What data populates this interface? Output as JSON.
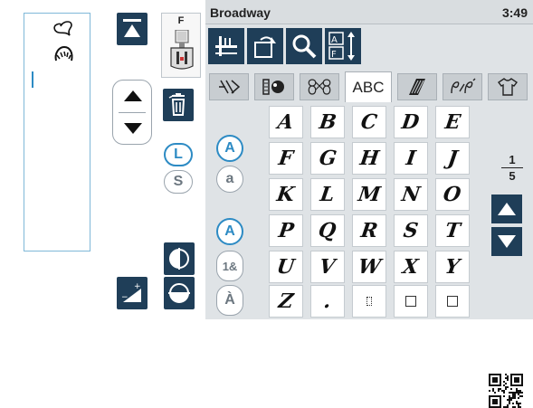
{
  "header": {
    "pattern_name": "Broadway",
    "clock": "3:49"
  },
  "left": {
    "presser_foot": "F",
    "case_upper": "L",
    "case_lower": "S"
  },
  "tabs": [
    {
      "label": "",
      "icon": "utility-stitch-icon"
    },
    {
      "label": "",
      "icon": "quilt-stitch-icon"
    },
    {
      "label": "",
      "icon": "decorative-stitch-icon"
    },
    {
      "label": "ABC",
      "icon": ""
    },
    {
      "label": "",
      "icon": "tapering-icon"
    },
    {
      "label": "",
      "icon": "motif-icon"
    },
    {
      "label": "",
      "icon": "garment-icon"
    }
  ],
  "active_tab": 3,
  "char_modes": {
    "uppercase": "A",
    "lowercase": "a",
    "numbers": "1&",
    "accented": "À"
  },
  "characters": [
    "A",
    "B",
    "C",
    "D",
    "E",
    "F",
    "G",
    "H",
    "I",
    "J",
    "K",
    "L",
    "M",
    "N",
    "O",
    "P",
    "Q",
    "R",
    "S",
    "T",
    "U",
    "V",
    "W",
    "X",
    "Y",
    "Z",
    "."
  ],
  "page": {
    "current": "1",
    "total": "5"
  },
  "colors": {
    "accent": "#2d8bc4",
    "dark_button": "#1f3e58",
    "panel": "#dfe3e6"
  }
}
